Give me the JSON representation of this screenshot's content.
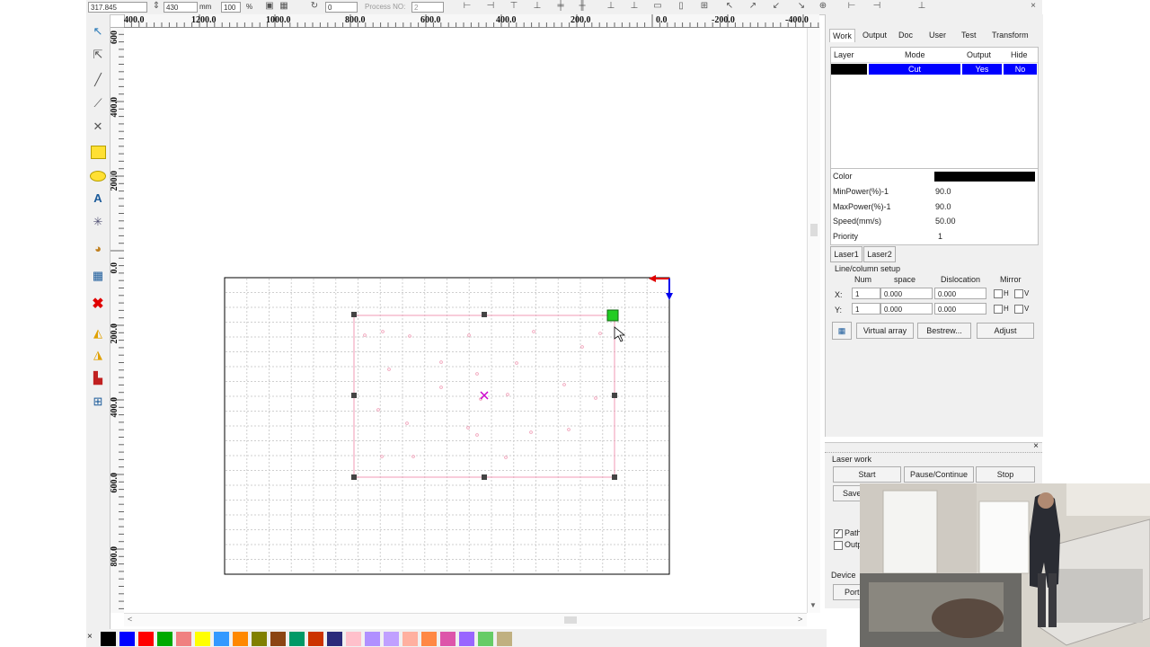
{
  "toolbar": {
    "coord_x": "317.845",
    "size_value": "430",
    "size_unit": "mm",
    "percent_value": "100",
    "percent_unit": "%",
    "rotate_value": "0",
    "process_label": "Process NO:",
    "process_value": "2"
  },
  "ruler": {
    "h_labels": [
      "400.0",
      "1200.0",
      "1000.0",
      "800.0",
      "600.0",
      "400.0",
      "200.0",
      "0.0",
      "-200.0",
      "-400.0"
    ],
    "v_labels": [
      "600",
      "400.0",
      "200.0",
      "0.0",
      "200.0",
      "400.0",
      "600.0",
      "800.0"
    ]
  },
  "panel": {
    "tabs": [
      "Work",
      "Output",
      "Doc",
      "User",
      "Test",
      "Transform"
    ],
    "layer_headers": [
      "Layer",
      "Mode",
      "Output",
      "Hide"
    ],
    "layer_row": {
      "mode": "Cut",
      "output": "Yes",
      "hide": "No"
    },
    "props": {
      "color_label": "Color",
      "min_power_label": "MinPower(%)-1",
      "min_power_value": "90.0",
      "max_power_label": "MaxPower(%)-1",
      "max_power_value": "90.0",
      "speed_label": "Speed(mm/s)",
      "speed_value": "50.00",
      "priority_label": "Priority",
      "priority_value": "1"
    },
    "laser_tabs": [
      "Laser1",
      "Laser2"
    ],
    "line_column_setup": "Line/column setup",
    "array_headers": [
      "Num",
      "space",
      "Dislocation",
      "Mirror"
    ],
    "row_x": {
      "label": "X:",
      "num": "1",
      "space": "0.000",
      "dislocation": "0.000",
      "h": "H",
      "v": "V"
    },
    "row_y": {
      "label": "Y:",
      "num": "1",
      "space": "0.000",
      "dislocation": "0.000",
      "h": "H",
      "v": "V"
    },
    "virtual_array": "Virtual array",
    "bestrew": "Bestrew...",
    "adjust": "Adjust"
  },
  "laser_work": {
    "title": "Laser work",
    "start": "Start",
    "pause": "Pause/Continue",
    "stop": "Stop",
    "save": "Save",
    "path_label": "Path",
    "output_label": "Outp",
    "device_label": "Device",
    "port_label": "Port"
  },
  "colors": {
    "accent_blue": "#0000ff",
    "layer_black": "#000000",
    "shape_pink": "#f09ab4",
    "selection_green": "#22cc22",
    "center_magenta": "#cc00cc",
    "grid": "#c8c8c8"
  },
  "palette": [
    "#000000",
    "#0000ff",
    "#ff0000",
    "#00aa00",
    "#f08080",
    "#ffff00",
    "#3399ff",
    "#ff8800",
    "#808000",
    "#8b4513",
    "#009966",
    "#cc3300",
    "#2a2a7a",
    "#ffc0cb",
    "#b090ff",
    "#c0a0ff",
    "#ffb0a0",
    "#ff8844",
    "#dd55aa",
    "#9966ff",
    "#66cc66",
    "#c0b080"
  ]
}
